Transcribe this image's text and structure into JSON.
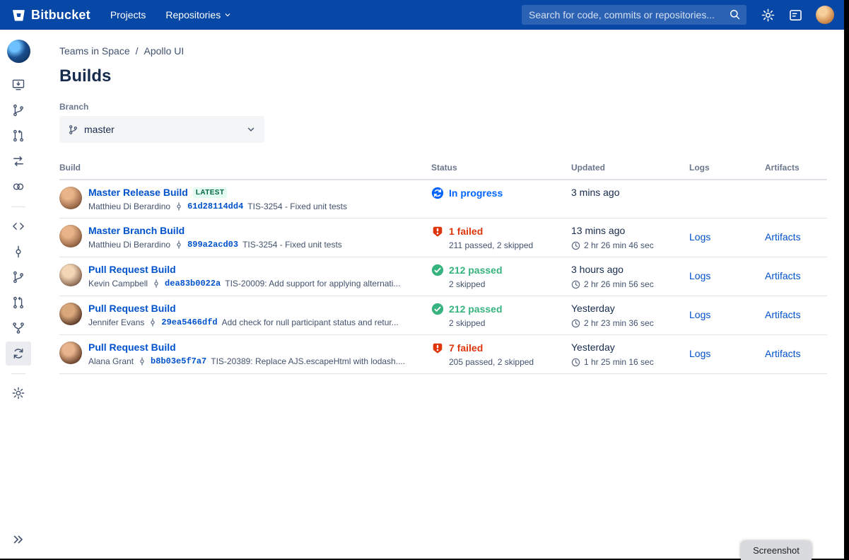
{
  "navbar": {
    "brand": "Bitbucket",
    "menu": [
      {
        "label": "Projects"
      },
      {
        "label": "Repositories"
      }
    ],
    "search_placeholder": "Search for code, commits or repositories..."
  },
  "breadcrumb": {
    "items": [
      "Teams in Space",
      "Apollo UI"
    ],
    "separator": "/"
  },
  "page": {
    "title": "Builds"
  },
  "branch_filter": {
    "label": "Branch",
    "selected": "master"
  },
  "table": {
    "headers": {
      "build": "Build",
      "status": "Status",
      "updated": "Updated",
      "logs": "Logs",
      "artifacts": "Artifacts"
    },
    "rows": [
      {
        "name": "Master Release Build",
        "badge": "LATEST",
        "author": "Matthieu Di Berardino",
        "commit": "61d28114dd4",
        "message": "TIS-3254 - Fixed unit tests",
        "status": {
          "state": "in-progress",
          "label": "In progress",
          "detail": ""
        },
        "updated": "3 mins ago",
        "duration": "",
        "logs": "",
        "artifacts": ""
      },
      {
        "name": "Master Branch Build",
        "author": "Matthieu Di Berardino",
        "commit": "899a2acd03",
        "message": "TIS-3254 - Fixed unit tests",
        "status": {
          "state": "failed",
          "label": "1 failed",
          "detail": "211 passed, 2 skipped"
        },
        "updated": "13 mins ago",
        "duration": "2 hr 26 min 46 sec",
        "logs": "Logs",
        "artifacts": "Artifacts"
      },
      {
        "name": "Pull Request Build",
        "author": "Kevin Campbell",
        "commit": "dea83b0022a",
        "message": "TIS-20009: Add support for applying alternati...",
        "status": {
          "state": "passed",
          "label": "212 passed",
          "detail": "2 skipped"
        },
        "updated": "3 hours ago",
        "duration": "2 hr 26 min 56 sec",
        "logs": "Logs",
        "artifacts": "Artifacts"
      },
      {
        "name": "Pull Request Build",
        "author": "Jennifer Evans",
        "commit": "29ea5466dfd",
        "message": "Add check for null participant status and retur...",
        "status": {
          "state": "passed",
          "label": "212 passed",
          "detail": "2 skipped"
        },
        "updated": "Yesterday",
        "duration": "2 hr 23 min 36 sec",
        "logs": "Logs",
        "artifacts": "Artifacts"
      },
      {
        "name": "Pull Request Build",
        "author": "Alana Grant",
        "commit": "b8b03e5f7a7",
        "message": "TIS-20389: Replace AJS.escapeHtml with lodash....",
        "status": {
          "state": "failed",
          "label": "7 failed",
          "detail": "205 passed, 2 skipped"
        },
        "updated": "Yesterday",
        "duration": "1 hr 25 min 16 sec",
        "logs": "Logs",
        "artifacts": "Artifacts"
      }
    ]
  },
  "overlay": {
    "screenshot_label": "Screenshot"
  },
  "colors": {
    "navbar": "#0747A6",
    "link": "#0052CC",
    "passed": "#36B37E",
    "failed": "#DE350B",
    "in_progress": "#0065FF",
    "badge_bg": "#E3FCEF",
    "badge_text": "#006644",
    "border": "#DFE1E6",
    "text": "#172B4D",
    "muted_text": "#42526E"
  }
}
